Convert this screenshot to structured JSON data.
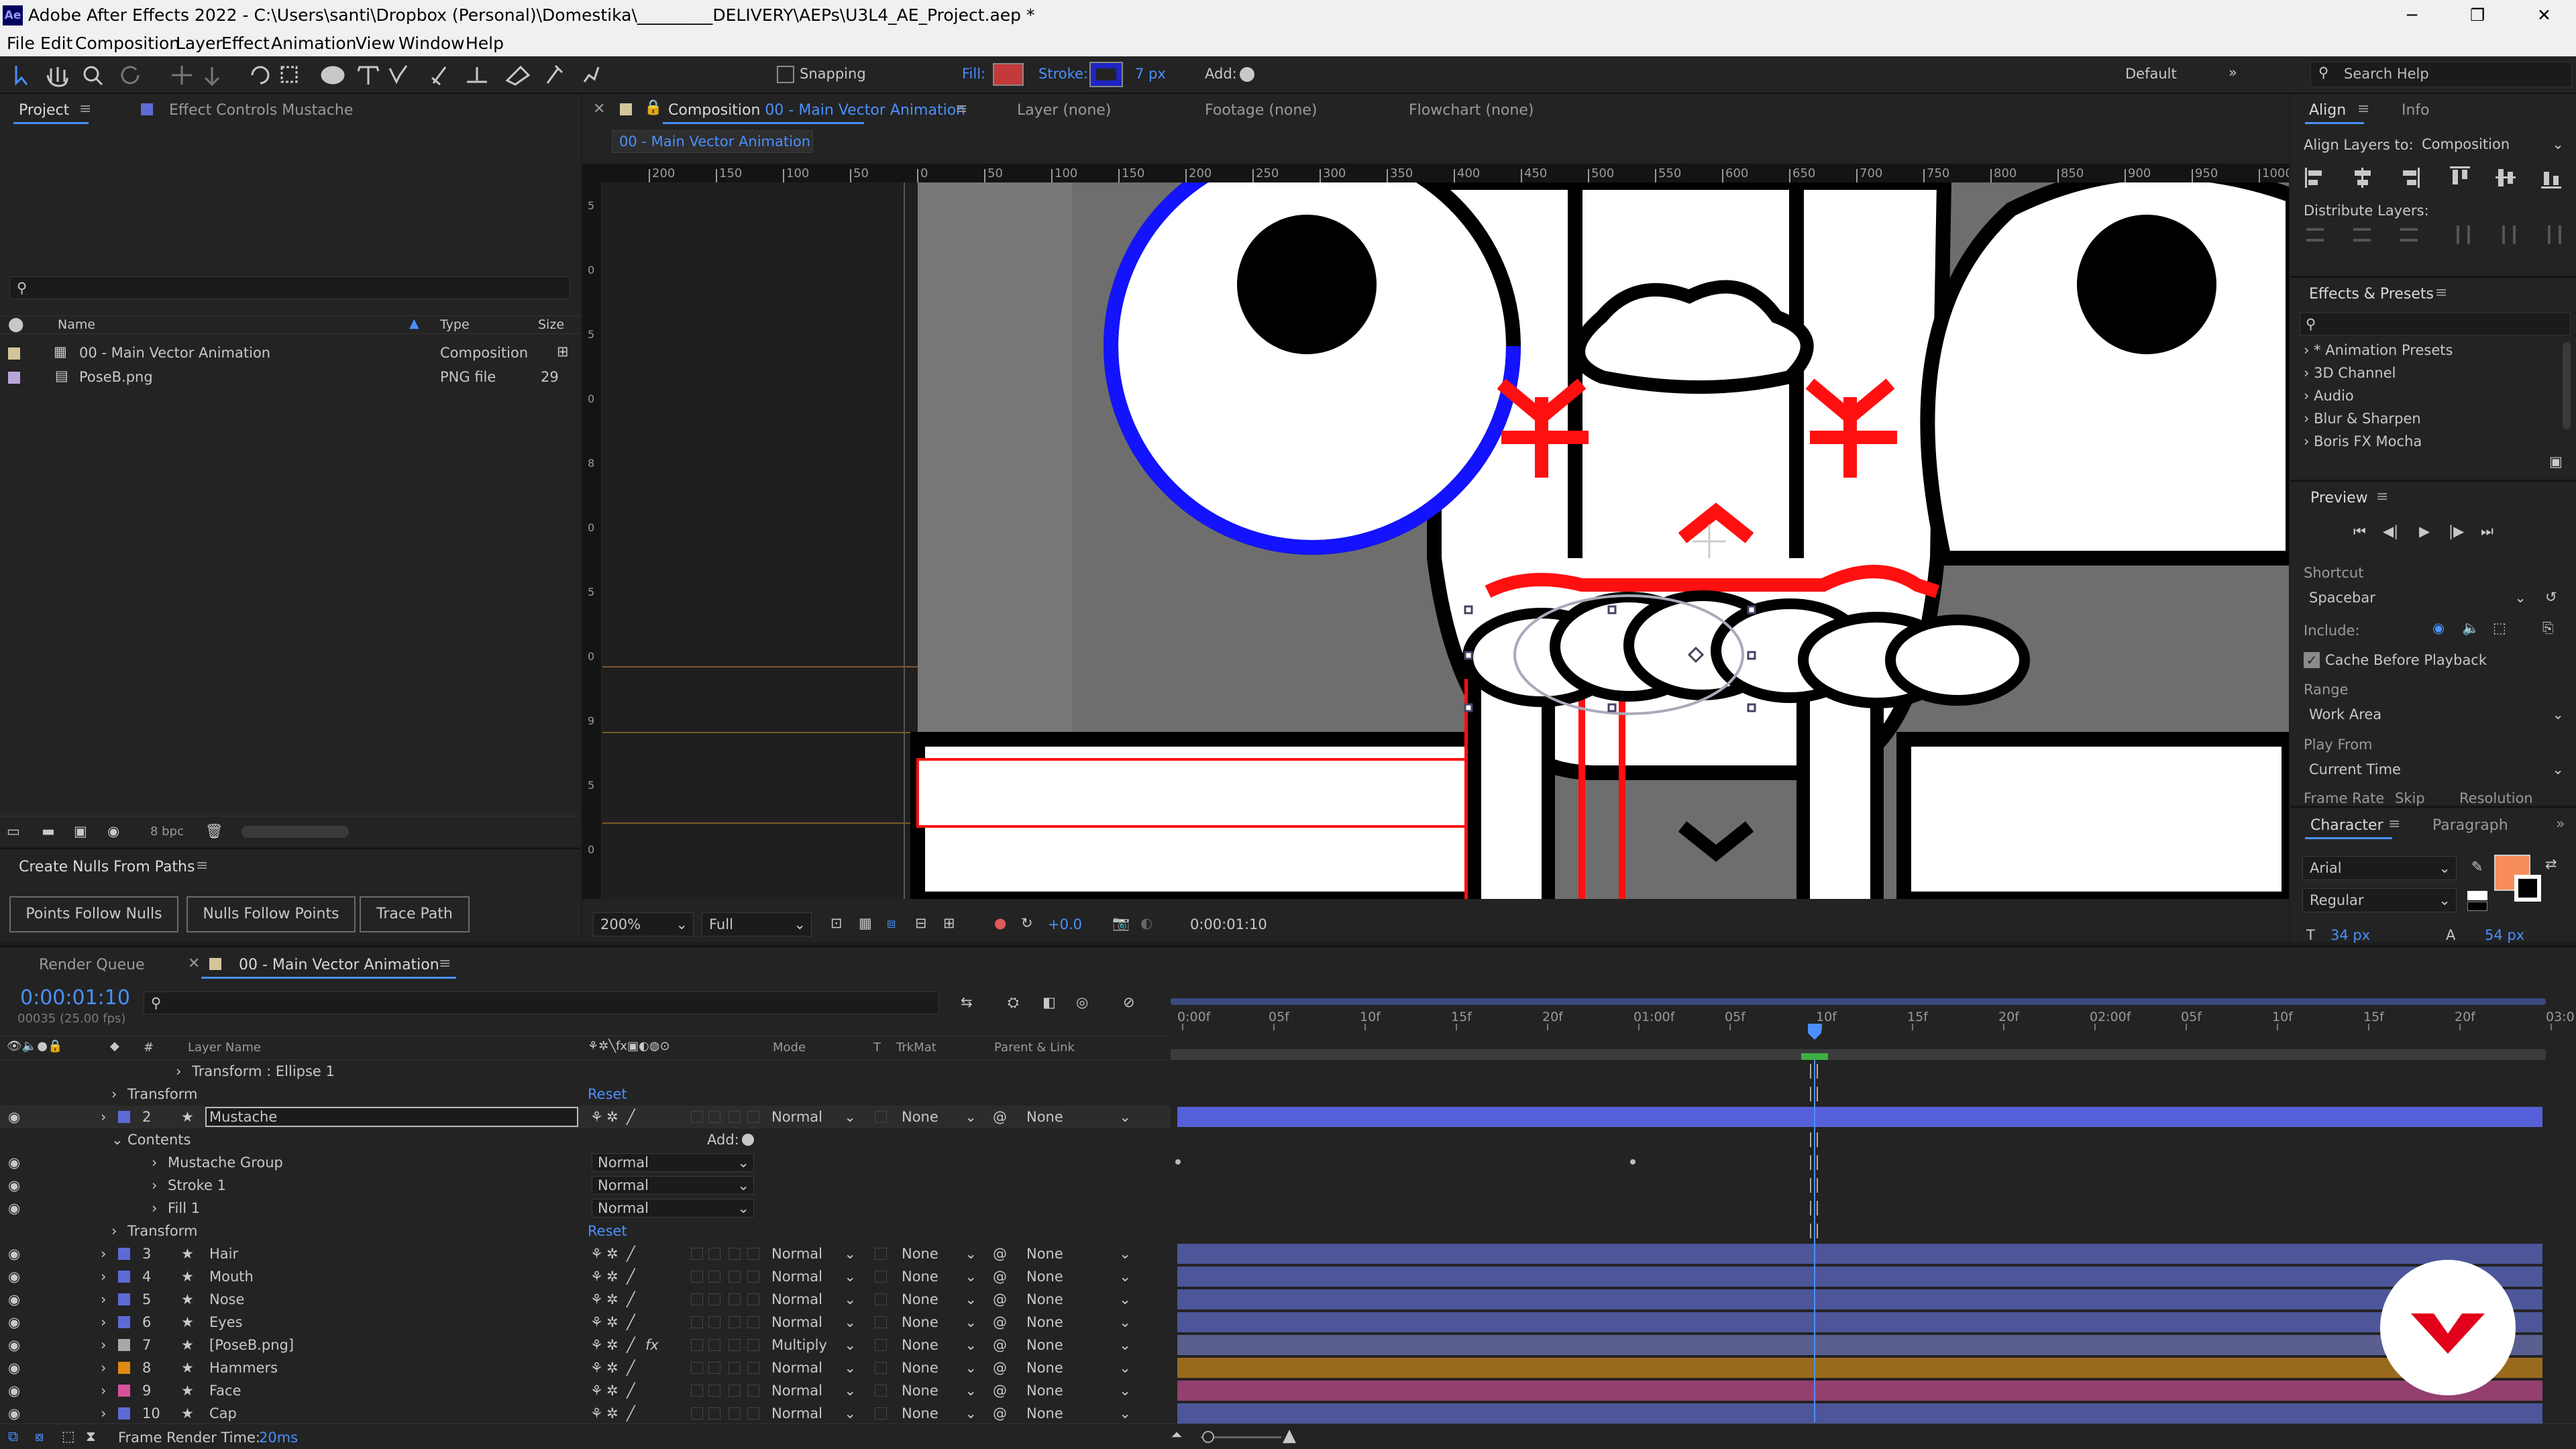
{
  "window": {
    "title": "Adobe After Effects 2022 - C:\\Users\\santi\\Dropbox (Personal)\\Domestika\\_________DELIVERY\\AEPs\\U3L4_AE_Project.aep *",
    "logo": "Ae",
    "controls": [
      "─",
      "❐",
      "✕"
    ]
  },
  "menu": [
    "File",
    "Edit",
    "Composition",
    "Layer",
    "Effect",
    "Animation",
    "View",
    "Window",
    "Help"
  ],
  "toolbar": {
    "snapping": "Snapping",
    "fill_label": "Fill:",
    "stroke_label": "Stroke:",
    "stroke_width": "7 px",
    "add_label": "Add:",
    "workspace": "Default",
    "search_placeholder": "Search Help",
    "fill_color": "#c33a3a",
    "stroke_color": "#1f24c4"
  },
  "project": {
    "tab": "Project",
    "effect_controls": "Effect Controls Mustache",
    "columns": [
      "Name",
      "Type",
      "Size"
    ],
    "items": [
      {
        "name": "00 - Main Vector Animation",
        "type": "Composition",
        "size": ""
      },
      {
        "name": "PoseB.png",
        "type": "PNG file",
        "size": "29"
      }
    ],
    "bpc": "8 bpc"
  },
  "nulls": {
    "title": "Create Nulls From Paths",
    "buttons": [
      "Points Follow Nulls",
      "Nulls Follow Points",
      "Trace Path"
    ]
  },
  "comp": {
    "tab_prefix": "Composition",
    "tab_name": "00 - Main Vector Animation",
    "layer_tab": "Layer  (none)",
    "footage_tab": "Footage  (none)",
    "flowchart_tab": "Flowchart  (none)",
    "breadcrumb": "00 - Main Vector Animation",
    "ruler": [
      "200",
      "150",
      "100",
      "50",
      "0",
      "50",
      "100",
      "150",
      "200",
      "250",
      "300",
      "350",
      "400",
      "450",
      "500",
      "550",
      "600",
      "650",
      "700",
      "750",
      "800",
      "850",
      "900",
      "950",
      "1000"
    ],
    "vruler": [
      "5",
      "0",
      "5",
      "0",
      "8",
      "0",
      "5",
      "0",
      "9",
      "5",
      "0"
    ],
    "zoom": "200%",
    "resolution": "Full",
    "exposure": "+0.0",
    "timecode": "0:00:01:10"
  },
  "align": {
    "tab": "Align",
    "info_tab": "Info",
    "align_to_label": "Align Layers to:",
    "align_to": "Composition",
    "distribute": "Distribute Layers:"
  },
  "effects": {
    "title": "Effects & Presets",
    "items": [
      "* Animation Presets",
      "3D Channel",
      "Audio",
      "Blur & Sharpen",
      "Boris FX Mocha"
    ]
  },
  "preview": {
    "title": "Preview",
    "shortcut_label": "Shortcut",
    "shortcut": "Spacebar",
    "include_label": "Include:",
    "cache": "Cache Before Playback",
    "range_label": "Range",
    "range": "Work Area",
    "playfrom_label": "Play From",
    "playfrom": "Current Time",
    "framerate_label": "Frame Rate",
    "skip_label": "Skip",
    "resolution_label": "Resolution"
  },
  "character": {
    "tab": "Character",
    "paragraph_tab": "Paragraph",
    "font": "Arial",
    "style": "Regular",
    "size": "34 px",
    "leading": "54 px",
    "fill": "#f78d5a"
  },
  "timeline": {
    "render_queue": "Render Queue",
    "tab": "00 - Main Vector Animation",
    "timecode": "0:00:01:10",
    "fps": "00035 (25.00 fps)",
    "col_layername": "Layer Name",
    "col_mode": "Mode",
    "col_t": "T",
    "col_trkmat": "TrkMat",
    "col_parent": "Parent & Link",
    "ruler": [
      "0:00f",
      "05f",
      "10f",
      "15f",
      "20f",
      "01:00f",
      "05f",
      "10f",
      "15f",
      "20f",
      "02:00f",
      "05f",
      "10f",
      "15f",
      "20f",
      "03:0"
    ],
    "rows": [
      {
        "indent": "sub",
        "label": "Transform : Ellipse 1"
      },
      {
        "indent": "prop",
        "label": "Transform",
        "value": "Reset"
      },
      {
        "kind": "layer",
        "num": "2",
        "name": "Mustache",
        "color": "#5d6bd6",
        "mode": "Normal",
        "trkmat": "None",
        "parent": "None",
        "selected": true
      },
      {
        "indent": "prop",
        "label": "Contents",
        "value": "Add:"
      },
      {
        "indent": "group",
        "label": "Mustache Group",
        "mode": "Normal"
      },
      {
        "indent": "group",
        "label": "Stroke 1",
        "mode": "Normal"
      },
      {
        "indent": "group",
        "label": "Fill 1",
        "mode": "Normal"
      },
      {
        "indent": "prop",
        "label": "Transform",
        "value": "Reset"
      },
      {
        "kind": "layer",
        "num": "3",
        "name": "Hair",
        "color": "#5d6bd6",
        "mode": "Normal",
        "trkmat": "None",
        "parent": "None"
      },
      {
        "kind": "layer",
        "num": "4",
        "name": "Mouth",
        "color": "#5d6bd6",
        "mode": "Normal",
        "trkmat": "None",
        "parent": "None"
      },
      {
        "kind": "layer",
        "num": "5",
        "name": "Nose",
        "color": "#5d6bd6",
        "mode": "Normal",
        "trkmat": "None",
        "parent": "None"
      },
      {
        "kind": "layer",
        "num": "6",
        "name": "Eyes",
        "color": "#5d6bd6",
        "mode": "Normal",
        "trkmat": "None",
        "parent": "None"
      },
      {
        "kind": "layer",
        "num": "7",
        "name": "[PoseB.png]",
        "color": "#a8a8a8",
        "mode": "Multiply",
        "trkmat": "None",
        "parent": "None",
        "fx": "fx"
      },
      {
        "kind": "layer",
        "num": "8",
        "name": "Hammers",
        "color": "#e08a12",
        "mode": "Normal",
        "trkmat": "None",
        "parent": "None"
      },
      {
        "kind": "layer",
        "num": "9",
        "name": "Face",
        "color": "#d6539c",
        "mode": "Normal",
        "trkmat": "None",
        "parent": "None"
      },
      {
        "kind": "layer",
        "num": "10",
        "name": "Cap",
        "color": "#5d6bd6",
        "mode": "Normal",
        "trkmat": "None",
        "parent": "None"
      }
    ],
    "render_time_label": "Frame Render Time:",
    "render_time": "20ms"
  }
}
